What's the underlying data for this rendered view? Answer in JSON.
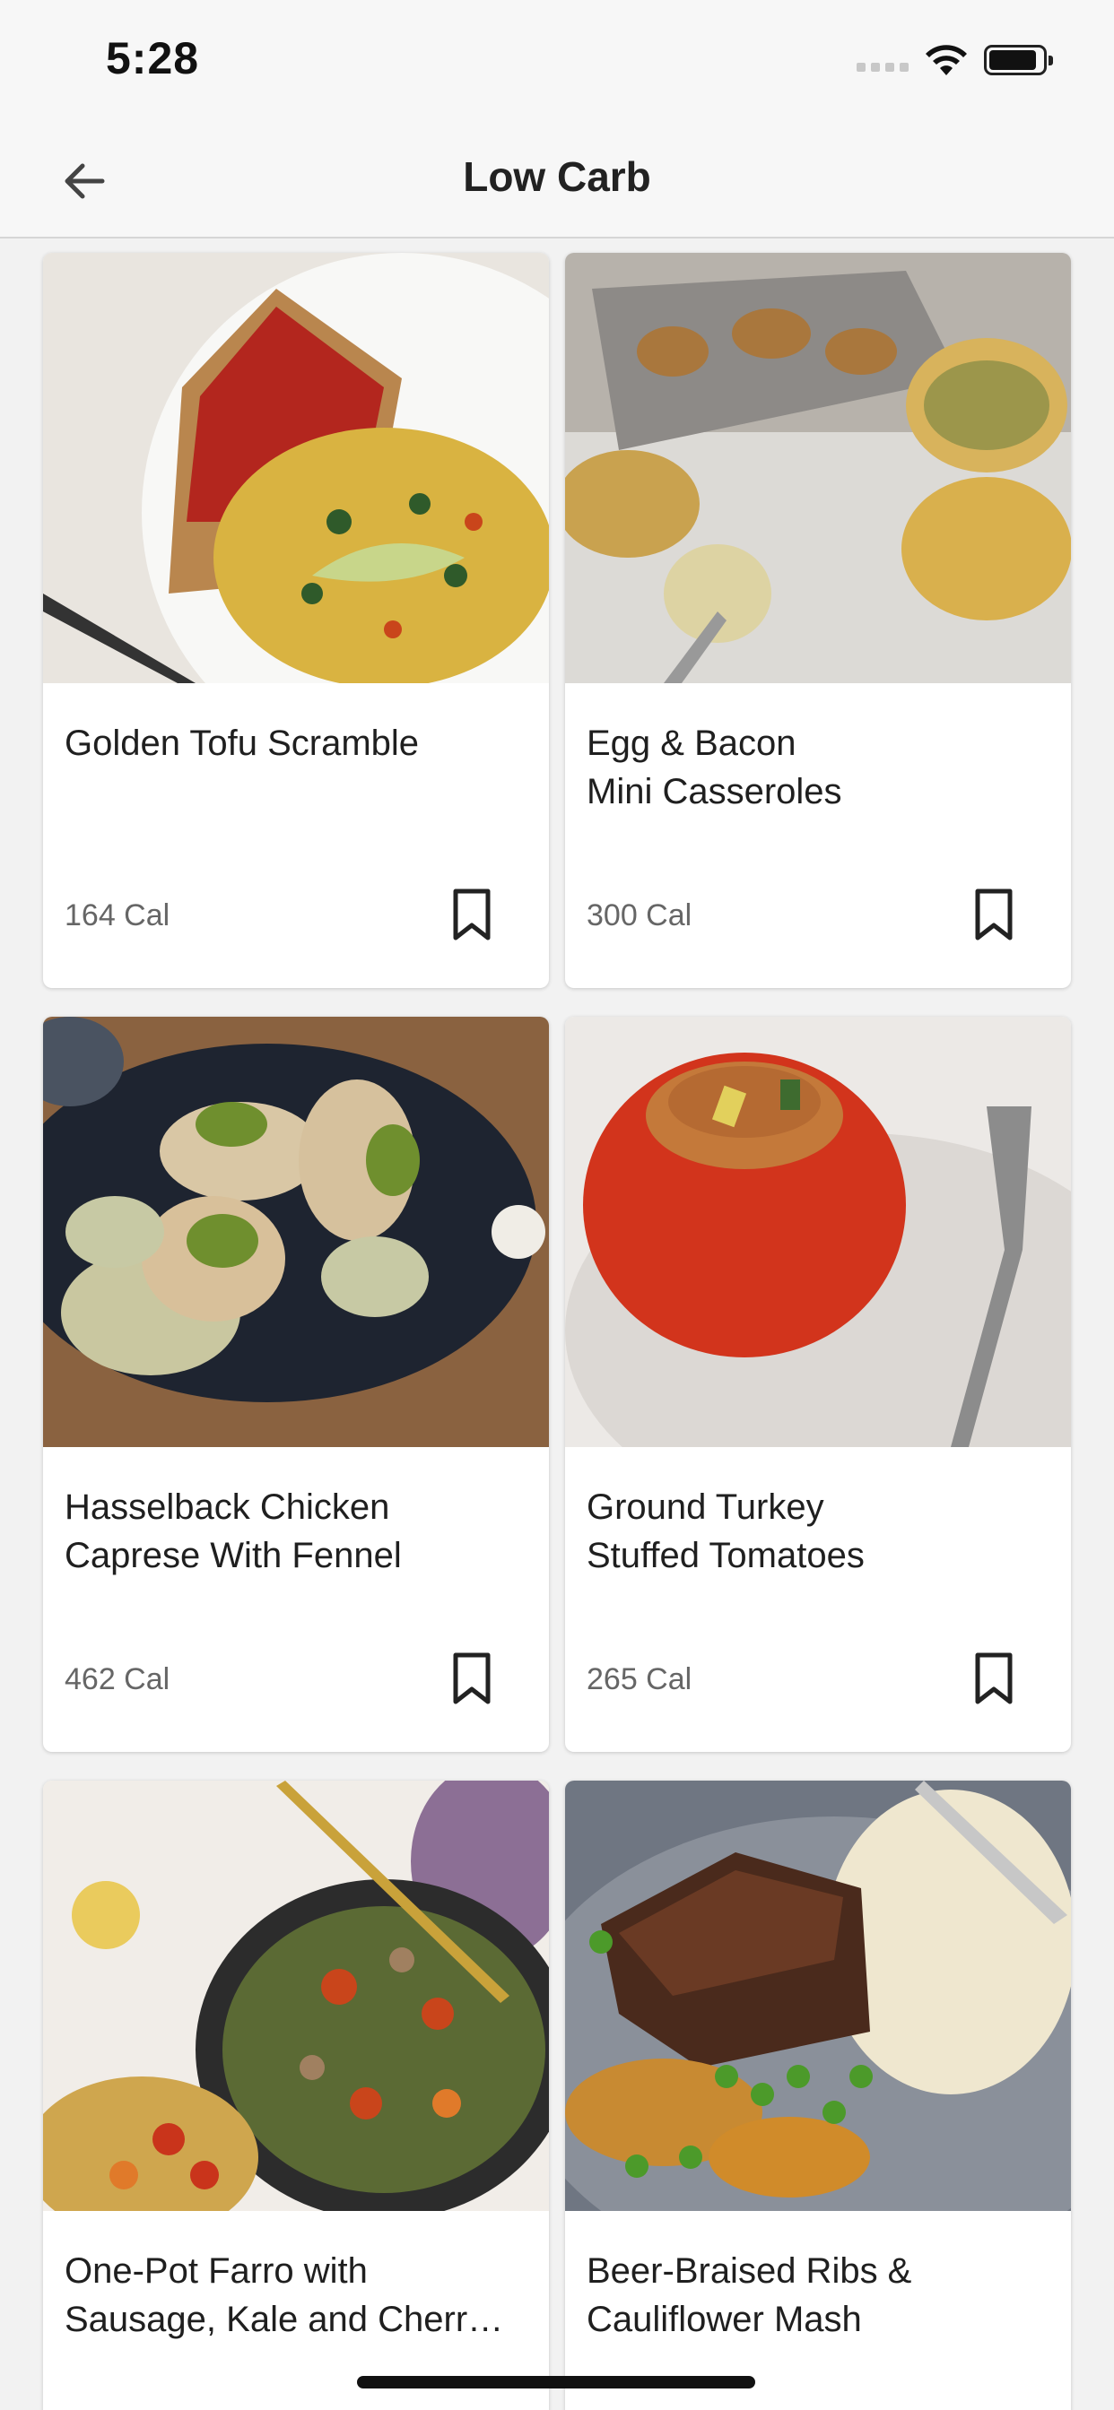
{
  "status": {
    "time": "5:28"
  },
  "nav": {
    "title": "Low Carb",
    "back_icon": "arrow-left-icon"
  },
  "recipes": [
    {
      "name_line1": "Golden Tofu Scramble",
      "name_line2": "",
      "calories": "164 Cal"
    },
    {
      "name_line1": "Egg & Bacon",
      "name_line2": "Mini Casseroles",
      "calories": "300 Cal"
    },
    {
      "name_line1": "Hasselback Chicken",
      "name_line2": "Caprese With Fennel",
      "calories": "462 Cal"
    },
    {
      "name_line1": "Ground Turkey",
      "name_line2": "Stuffed Tomatoes",
      "calories": "265 Cal"
    },
    {
      "name_line1": "One-Pot Farro with",
      "name_line2": "Sausage, Kale and Cherr…",
      "calories": ""
    },
    {
      "name_line1": "Beer-Braised Ribs &",
      "name_line2": "Cauliflower Mash",
      "calories": ""
    }
  ],
  "icons": {
    "bookmark": "bookmark-icon"
  },
  "colors": {
    "background": "#f2f2f2",
    "card": "#ffffff",
    "text": "#1f1f1f",
    "muted": "#666666"
  }
}
